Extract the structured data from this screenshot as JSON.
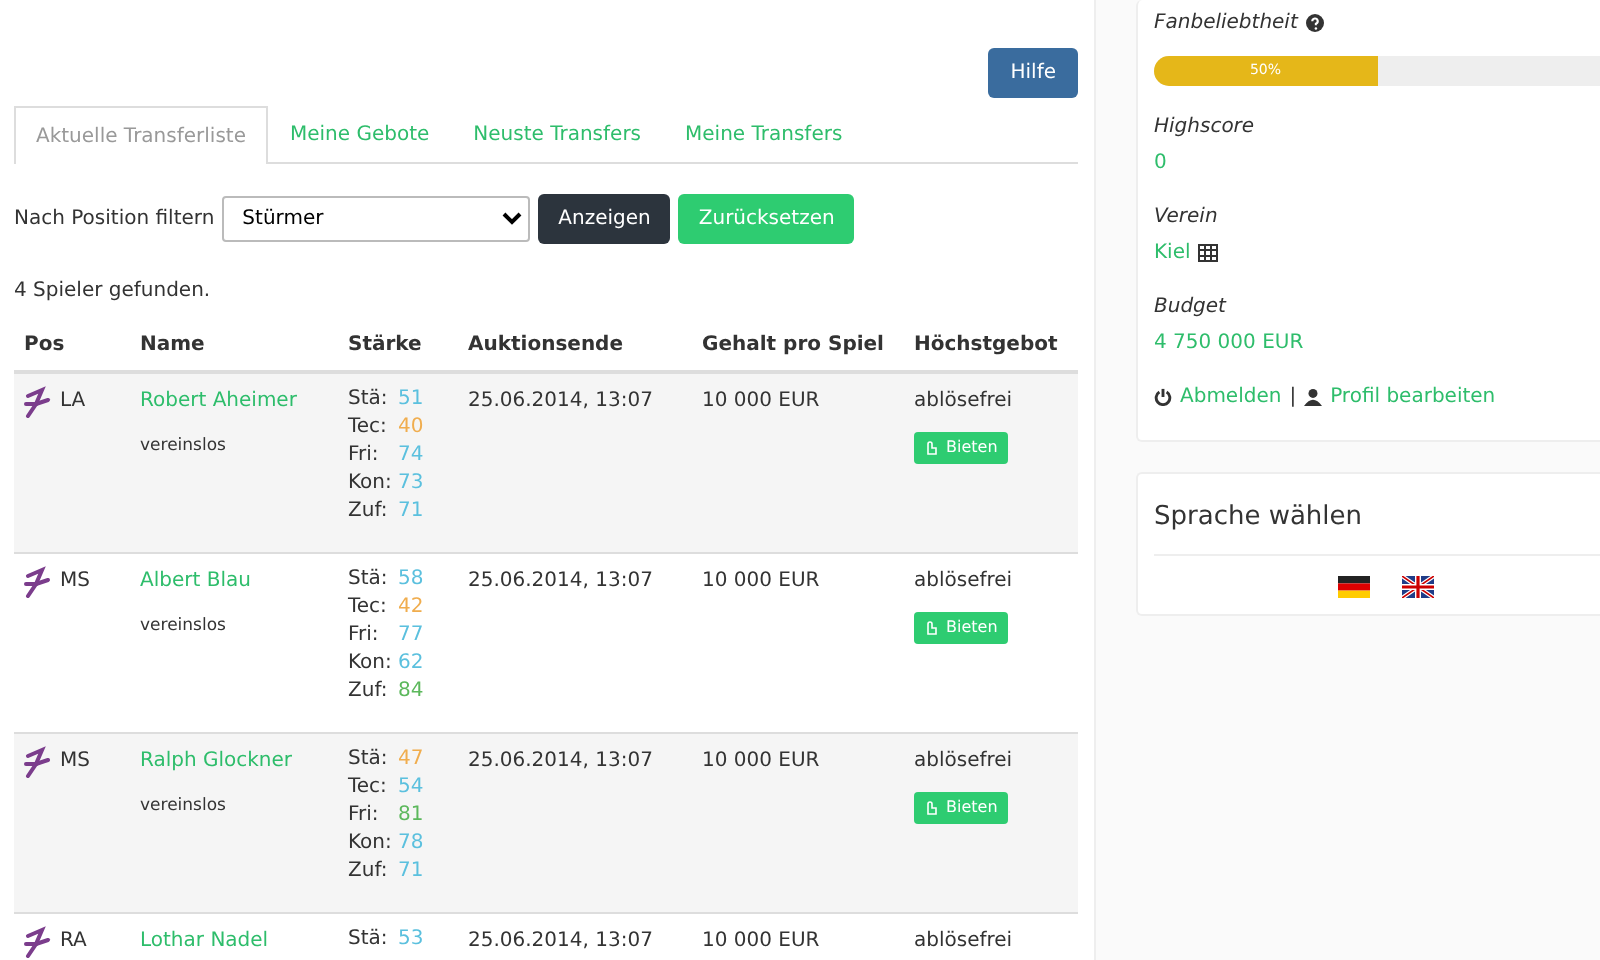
{
  "help_button": "Hilfe",
  "tabs": [
    {
      "label": "Aktuelle Transferliste",
      "selected": true
    },
    {
      "label": "Meine Gebote",
      "selected": false
    },
    {
      "label": "Neuste Transfers",
      "selected": false
    },
    {
      "label": "Meine Transfers",
      "selected": false
    }
  ],
  "filter": {
    "label": "Nach Position filtern",
    "value": "Stürmer",
    "buttons": [
      {
        "label": "Anzeigen",
        "kind": "dark"
      },
      {
        "label": "Zurücksetzen",
        "kind": "success"
      }
    ]
  },
  "result_text": "4 Spieler gefunden.",
  "table": {
    "columns": [
      "Pos",
      "Name",
      "Stärke",
      "Auktionsende",
      "Gehalt pro Spiel",
      "Höchstgebot"
    ],
    "rows": [
      {
        "pos": "LA",
        "name": "Robert Aheimer",
        "club": "vereinslos",
        "stats": [
          {
            "label": "Stä:",
            "value": "51",
            "color": "#5bc0de"
          },
          {
            "label": "Tec:",
            "value": "40",
            "color": "#f0ad4e"
          },
          {
            "label": "Fri:",
            "value": "74",
            "color": "#5bc0de"
          },
          {
            "label": "Kon:",
            "value": "73",
            "color": "#5bc0de"
          },
          {
            "label": "Zuf:",
            "value": "71",
            "color": "#5bc0de"
          }
        ],
        "auction_end": "25.06.2014, 13:07",
        "salary": "10 000 EUR",
        "highest_bid": "ablösefrei",
        "bid_button": "Bieten"
      },
      {
        "pos": "MS",
        "name": "Albert Blau",
        "club": "vereinslos",
        "stats": [
          {
            "label": "Stä:",
            "value": "58",
            "color": "#5bc0de"
          },
          {
            "label": "Tec:",
            "value": "42",
            "color": "#f0ad4e"
          },
          {
            "label": "Fri:",
            "value": "77",
            "color": "#5bc0de"
          },
          {
            "label": "Kon:",
            "value": "62",
            "color": "#5bc0de"
          },
          {
            "label": "Zuf:",
            "value": "84",
            "color": "#5cb85c"
          }
        ],
        "auction_end": "25.06.2014, 13:07",
        "salary": "10 000 EUR",
        "highest_bid": "ablösefrei",
        "bid_button": "Bieten"
      },
      {
        "pos": "MS",
        "name": "Ralph Glockner",
        "club": "vereinslos",
        "stats": [
          {
            "label": "Stä:",
            "value": "47",
            "color": "#f0ad4e"
          },
          {
            "label": "Tec:",
            "value": "54",
            "color": "#5bc0de"
          },
          {
            "label": "Fri:",
            "value": "81",
            "color": "#5cb85c"
          },
          {
            "label": "Kon:",
            "value": "78",
            "color": "#5bc0de"
          },
          {
            "label": "Zuf:",
            "value": "71",
            "color": "#5bc0de"
          }
        ],
        "auction_end": "25.06.2014, 13:07",
        "salary": "10 000 EUR",
        "highest_bid": "ablösefrei",
        "bid_button": "Bieten"
      },
      {
        "pos": "RA",
        "name": "Lothar Nadel",
        "stats": [
          {
            "label": "Stä:",
            "value": "53",
            "color": "#5bc0de"
          }
        ],
        "auction_end": "25.06.2014, 13:07",
        "salary": "10 000 EUR",
        "highest_bid": "ablösefrei"
      }
    ]
  },
  "sidebar": {
    "fan_popularity": {
      "label": "Fanbeliebtheit",
      "level": 0.5,
      "reading": "50%"
    },
    "fields": [
      {
        "label": "Highscore",
        "value": "0",
        "kind": "text"
      },
      {
        "label": "Verein",
        "value": "Kiel",
        "kind": "club"
      },
      {
        "label": "Budget",
        "value": "4 750 000 EUR",
        "kind": "text"
      }
    ],
    "links": [
      {
        "label": "Abmelden",
        "kind": "logout"
      },
      {
        "label": "Profil bearbeiten",
        "kind": "profile"
      }
    ],
    "separator": "|",
    "language": {
      "title": "Sprache wählen",
      "flags": [
        {
          "kind": "de"
        },
        {
          "kind": "gb"
        }
      ]
    }
  }
}
